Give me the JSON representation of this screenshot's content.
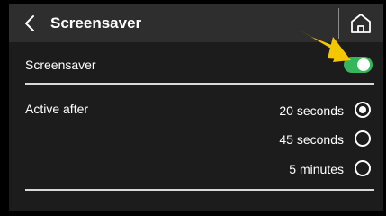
{
  "header": {
    "back_icon": "chevron-left-icon",
    "title": "Screensaver",
    "home_icon": "home-icon"
  },
  "screensaver_row": {
    "label": "Screensaver",
    "toggle_on": true,
    "toggle_color": "#35b65a"
  },
  "active_after": {
    "label": "Active after",
    "options": [
      {
        "label": "20 seconds",
        "selected": true
      },
      {
        "label": "45 seconds",
        "selected": false
      },
      {
        "label": "5 minutes",
        "selected": false
      }
    ]
  },
  "annotation": {
    "pointer_color": "#f4c800",
    "pointer_icon": "arrow-pointer-icon"
  },
  "colors": {
    "background": "#1c1c1c",
    "header": "#2e2e2e",
    "text": "#ffffff"
  }
}
